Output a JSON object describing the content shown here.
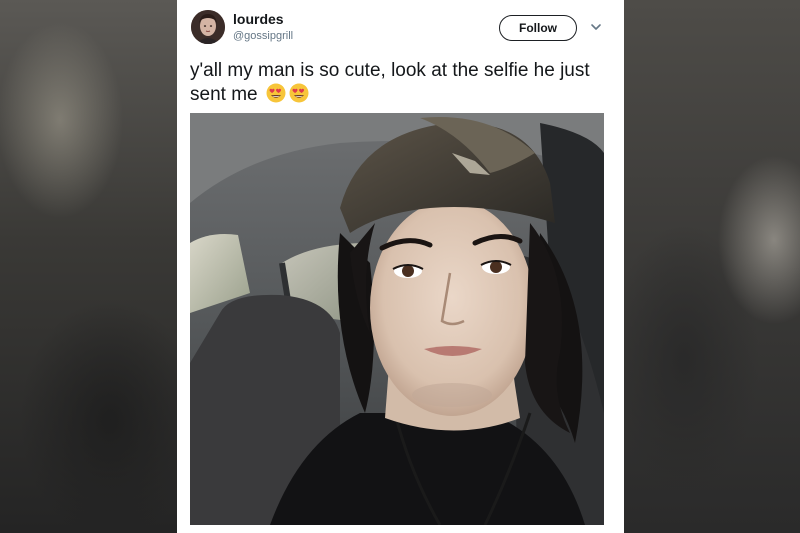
{
  "tweet": {
    "author_name": "lourdes",
    "author_handle": "@gossipgrill",
    "follow_label": "Follow",
    "text": "y'all my man is so cute, look at the selfie he just sent me",
    "emojis": [
      "heart-eyes-emoji",
      "heart-eyes-emoji"
    ]
  },
  "icons": {
    "chevron": "chevron-down-icon",
    "avatar": "avatar"
  },
  "colors": {
    "follow_border": "#1d2024",
    "handle": "#657786",
    "text": "#14171a",
    "card": "#ffffff"
  }
}
